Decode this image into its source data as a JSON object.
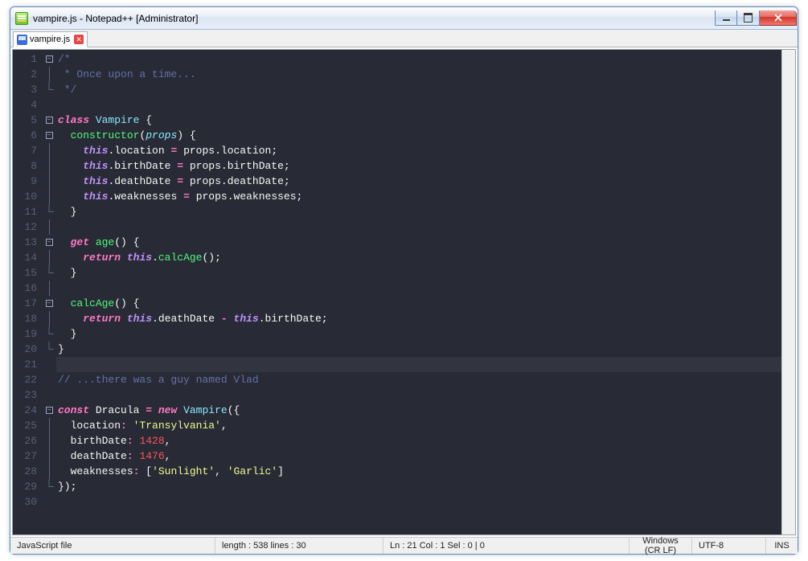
{
  "window": {
    "title": "vampire.js - Notepad++ [Administrator]"
  },
  "tab": {
    "filename": "vampire.js"
  },
  "editor": {
    "active_line": 21,
    "line_count": 30,
    "lines": [
      [
        {
          "c": "c-comment",
          "t": "/*"
        }
      ],
      [
        {
          "c": "c-comment",
          "t": " * Once upon a time..."
        }
      ],
      [
        {
          "c": "c-comment",
          "t": " */"
        }
      ],
      [],
      [
        {
          "c": "c-keyword",
          "t": "class"
        },
        {
          "c": "c-plain",
          "t": " "
        },
        {
          "c": "c-class",
          "t": "Vampire"
        },
        {
          "c": "c-plain",
          "t": " {"
        }
      ],
      [
        {
          "c": "c-plain",
          "t": "  "
        },
        {
          "c": "c-fn",
          "t": "constructor"
        },
        {
          "c": "c-punc",
          "t": "("
        },
        {
          "c": "c-prop",
          "t": "props"
        },
        {
          "c": "c-punc",
          "t": ") {"
        }
      ],
      [
        {
          "c": "c-plain",
          "t": "    "
        },
        {
          "c": "c-this",
          "t": "this"
        },
        {
          "c": "c-punc",
          "t": "."
        },
        {
          "c": "c-plain",
          "t": "location "
        },
        {
          "c": "c-kw2",
          "t": "="
        },
        {
          "c": "c-plain",
          "t": " props"
        },
        {
          "c": "c-punc",
          "t": "."
        },
        {
          "c": "c-plain",
          "t": "location"
        },
        {
          "c": "c-punc",
          "t": ";"
        }
      ],
      [
        {
          "c": "c-plain",
          "t": "    "
        },
        {
          "c": "c-this",
          "t": "this"
        },
        {
          "c": "c-punc",
          "t": "."
        },
        {
          "c": "c-plain",
          "t": "birthDate "
        },
        {
          "c": "c-kw2",
          "t": "="
        },
        {
          "c": "c-plain",
          "t": " props"
        },
        {
          "c": "c-punc",
          "t": "."
        },
        {
          "c": "c-plain",
          "t": "birthDate"
        },
        {
          "c": "c-punc",
          "t": ";"
        }
      ],
      [
        {
          "c": "c-plain",
          "t": "    "
        },
        {
          "c": "c-this",
          "t": "this"
        },
        {
          "c": "c-punc",
          "t": "."
        },
        {
          "c": "c-plain",
          "t": "deathDate "
        },
        {
          "c": "c-kw2",
          "t": "="
        },
        {
          "c": "c-plain",
          "t": " props"
        },
        {
          "c": "c-punc",
          "t": "."
        },
        {
          "c": "c-plain",
          "t": "deathDate"
        },
        {
          "c": "c-punc",
          "t": ";"
        }
      ],
      [
        {
          "c": "c-plain",
          "t": "    "
        },
        {
          "c": "c-this",
          "t": "this"
        },
        {
          "c": "c-punc",
          "t": "."
        },
        {
          "c": "c-plain",
          "t": "weaknesses "
        },
        {
          "c": "c-kw2",
          "t": "="
        },
        {
          "c": "c-plain",
          "t": " props"
        },
        {
          "c": "c-punc",
          "t": "."
        },
        {
          "c": "c-plain",
          "t": "weaknesses"
        },
        {
          "c": "c-punc",
          "t": ";"
        }
      ],
      [
        {
          "c": "c-punc",
          "t": "  }"
        }
      ],
      [],
      [
        {
          "c": "c-plain",
          "t": "  "
        },
        {
          "c": "c-keyword",
          "t": "get"
        },
        {
          "c": "c-plain",
          "t": " "
        },
        {
          "c": "c-fn",
          "t": "age"
        },
        {
          "c": "c-punc",
          "t": "() {"
        }
      ],
      [
        {
          "c": "c-plain",
          "t": "    "
        },
        {
          "c": "c-keyword",
          "t": "return"
        },
        {
          "c": "c-plain",
          "t": " "
        },
        {
          "c": "c-this",
          "t": "this"
        },
        {
          "c": "c-punc",
          "t": "."
        },
        {
          "c": "c-fn",
          "t": "calcAge"
        },
        {
          "c": "c-punc",
          "t": "();"
        }
      ],
      [
        {
          "c": "c-punc",
          "t": "  }"
        }
      ],
      [],
      [
        {
          "c": "c-plain",
          "t": "  "
        },
        {
          "c": "c-fn",
          "t": "calcAge"
        },
        {
          "c": "c-punc",
          "t": "() {"
        }
      ],
      [
        {
          "c": "c-plain",
          "t": "    "
        },
        {
          "c": "c-keyword",
          "t": "return"
        },
        {
          "c": "c-plain",
          "t": " "
        },
        {
          "c": "c-this",
          "t": "this"
        },
        {
          "c": "c-punc",
          "t": "."
        },
        {
          "c": "c-plain",
          "t": "deathDate "
        },
        {
          "c": "c-kw2",
          "t": "-"
        },
        {
          "c": "c-plain",
          "t": " "
        },
        {
          "c": "c-this",
          "t": "this"
        },
        {
          "c": "c-punc",
          "t": "."
        },
        {
          "c": "c-plain",
          "t": "birthDate"
        },
        {
          "c": "c-punc",
          "t": ";"
        }
      ],
      [
        {
          "c": "c-punc",
          "t": "  }"
        }
      ],
      [
        {
          "c": "c-punc",
          "t": "}"
        }
      ],
      [],
      [
        {
          "c": "c-comment",
          "t": "// ...there was a guy named Vlad"
        }
      ],
      [],
      [
        {
          "c": "c-keyword",
          "t": "const"
        },
        {
          "c": "c-plain",
          "t": " Dracula "
        },
        {
          "c": "c-kw2",
          "t": "="
        },
        {
          "c": "c-plain",
          "t": " "
        },
        {
          "c": "c-keyword",
          "t": "new"
        },
        {
          "c": "c-plain",
          "t": " "
        },
        {
          "c": "c-class",
          "t": "Vampire"
        },
        {
          "c": "c-punc",
          "t": "({"
        }
      ],
      [
        {
          "c": "c-plain",
          "t": "  location"
        },
        {
          "c": "c-kw2",
          "t": ":"
        },
        {
          "c": "c-plain",
          "t": " "
        },
        {
          "c": "c-string",
          "t": "'Transylvania'"
        },
        {
          "c": "c-punc",
          "t": ","
        }
      ],
      [
        {
          "c": "c-plain",
          "t": "  birthDate"
        },
        {
          "c": "c-kw2",
          "t": ":"
        },
        {
          "c": "c-plain",
          "t": " "
        },
        {
          "c": "c-num",
          "t": "1428"
        },
        {
          "c": "c-punc",
          "t": ","
        }
      ],
      [
        {
          "c": "c-plain",
          "t": "  deathDate"
        },
        {
          "c": "c-kw2",
          "t": ":"
        },
        {
          "c": "c-plain",
          "t": " "
        },
        {
          "c": "c-num",
          "t": "1476"
        },
        {
          "c": "c-punc",
          "t": ","
        }
      ],
      [
        {
          "c": "c-plain",
          "t": "  weaknesses"
        },
        {
          "c": "c-kw2",
          "t": ":"
        },
        {
          "c": "c-plain",
          "t": " "
        },
        {
          "c": "c-punc",
          "t": "["
        },
        {
          "c": "c-string",
          "t": "'Sunlight'"
        },
        {
          "c": "c-punc",
          "t": ", "
        },
        {
          "c": "c-string",
          "t": "'Garlic'"
        },
        {
          "c": "c-punc",
          "t": "]"
        }
      ],
      [
        {
          "c": "c-punc",
          "t": "});"
        }
      ],
      []
    ],
    "fold_markers": {
      "1": "open",
      "5": "open",
      "6": "open",
      "13": "open",
      "17": "open",
      "24": "open"
    }
  },
  "statusbar": {
    "language": "JavaScript file",
    "length_label": "length : 538    lines : 30",
    "position": "Ln : 21    Col : 1    Sel : 0 | 0",
    "eol": "Windows (CR LF)",
    "encoding": "UTF-8",
    "mode": "INS"
  }
}
